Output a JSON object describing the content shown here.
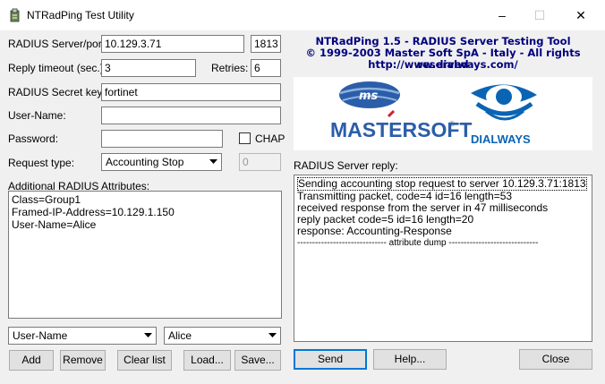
{
  "window": {
    "title": "NTRadPing Test Utility",
    "controls": [
      "–",
      "☐",
      "✕"
    ]
  },
  "form": {
    "server_label": "RADIUS Server/port:",
    "server_value": "10.129.3.71",
    "port_value": "1813",
    "timeout_label": "Reply timeout (sec.):",
    "timeout_value": "3",
    "retries_label": "Retries:",
    "retries_value": "6",
    "secret_label": "RADIUS Secret key:",
    "secret_value": "fortinet",
    "username_label": "User-Name:",
    "username_value": "",
    "password_label": "Password:",
    "password_value": "",
    "chap_label": "CHAP",
    "request_type_label": "Request type:",
    "request_type_value": "Accounting Stop",
    "request_num_value": "0",
    "attrs_label": "Additional RADIUS Attributes:",
    "attrs_lines": [
      "Class=Group1",
      "Framed-IP-Address=10.129.1.150",
      "User-Name=Alice"
    ],
    "attr_name_value": "User-Name",
    "attr_value_value": "Alice"
  },
  "buttons": {
    "add": "Add",
    "remove": "Remove",
    "clear": "Clear list",
    "load": "Load...",
    "save": "Save...",
    "send": "Send",
    "help": "Help...",
    "close": "Close"
  },
  "header": {
    "line1": "NTRadPing 1.5 - RADIUS Server Testing Tool",
    "line2": "© 1999-2003 Master Soft SpA - Italy - All rights reserved",
    "line3": "http://www.dialways.com/"
  },
  "logos": {
    "mastersoft_badge": "ms",
    "mastersoft": "MASTERSOFT",
    "mastersoft_reg": "®",
    "dialways": "DIALWAYS"
  },
  "reply": {
    "label": "RADIUS Server reply:",
    "lines": [
      "Sending accounting stop request to server 10.129.3.71:1813",
      "Transmitting packet, code=4 id=16 length=53",
      "received response from the server in 47 milliseconds",
      "reply packet code=5 id=16 length=20",
      "response: Accounting-Response",
      "------------------------------ attribute dump ------------------------------"
    ]
  },
  "colors": {
    "header_text": "#00007f",
    "mastersoft_blue": "#2b5ea8",
    "mastersoft_red": "#d02030",
    "dialways_blue": "#0a64b4"
  }
}
